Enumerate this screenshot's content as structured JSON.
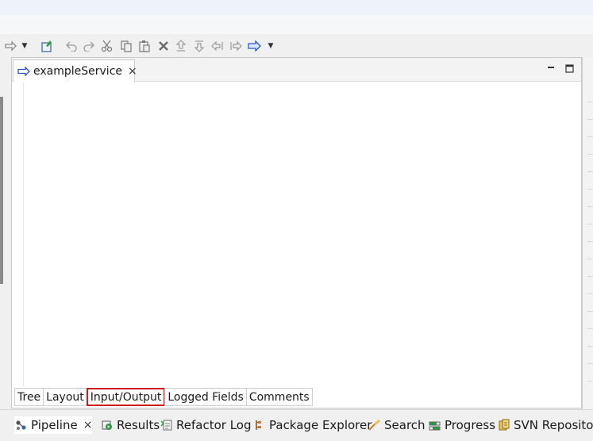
{
  "editor": {
    "tab_label": "exampleService",
    "close_glyph": "×",
    "subtabs": [
      {
        "label": "Tree"
      },
      {
        "label": "Layout"
      },
      {
        "label": "Input/Output",
        "focused": true
      },
      {
        "label": "Logged Fields"
      },
      {
        "label": "Comments"
      }
    ]
  },
  "bottom_tabs": [
    {
      "label": "Pipeline",
      "icon": "pipeline-icon",
      "active": true
    },
    {
      "label": "Results",
      "icon": "results-icon"
    },
    {
      "label": "Refactor Log",
      "icon": "refactor-log-icon"
    },
    {
      "label": "Package Explorer",
      "icon": "package-explorer-icon"
    },
    {
      "label": "Search",
      "icon": "search-icon"
    },
    {
      "label": "Progress",
      "icon": "progress-icon"
    },
    {
      "label": "SVN Repositori",
      "icon": "svn-repositories-icon"
    }
  ],
  "colors": {
    "focus_outline": "#d01a1a",
    "accent_blue": "#2a56c6"
  }
}
